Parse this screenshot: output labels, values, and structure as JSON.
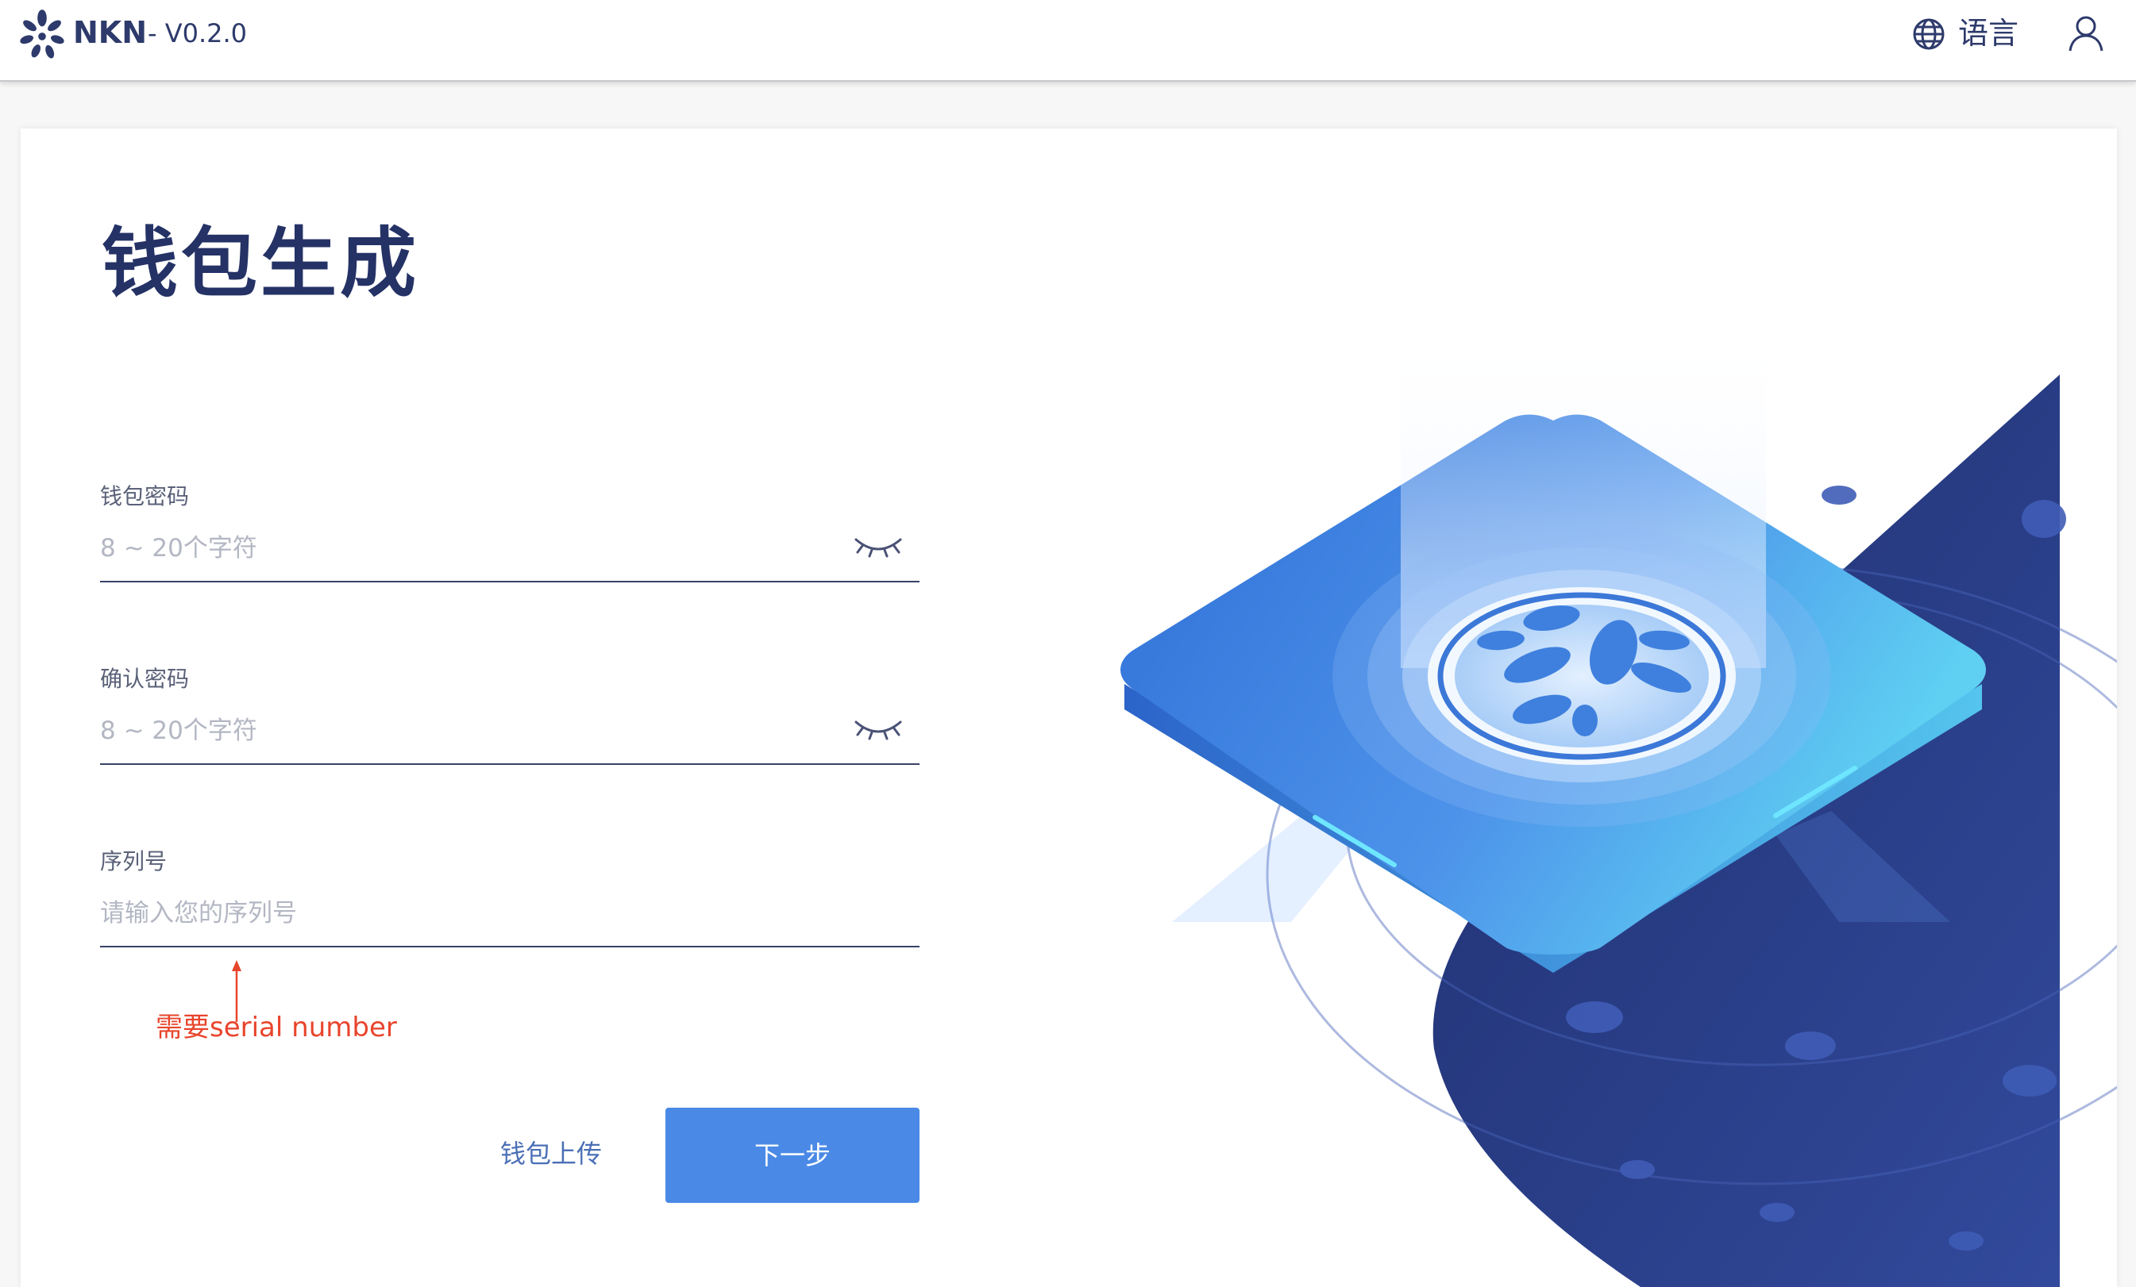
{
  "header": {
    "brand": "NKN",
    "version": "- V0.2.0",
    "language_label": "语言"
  },
  "form": {
    "title": "钱包生成",
    "password": {
      "label": "钱包密码",
      "placeholder": "8 ~ 20个字符",
      "value": ""
    },
    "confirm_password": {
      "label": "确认密码",
      "placeholder": "8 ~ 20个字符",
      "value": ""
    },
    "serial": {
      "label": "序列号",
      "placeholder": "请输入您的序列号",
      "value": ""
    },
    "annotation": "需要serial number",
    "upload_link": "钱包上传",
    "next_button": "下一步"
  },
  "icons": {
    "logo": "nkn-flower-logo",
    "language": "globe-icon",
    "user": "user-icon",
    "password_toggle": "eye-closed-icon"
  },
  "colors": {
    "brand": "#2d3a6b",
    "title": "#253266",
    "primary_button": "#4a8ae6",
    "link": "#4a6fb5",
    "annotation": "#e8452c",
    "illustration_dark": "#2a3d8a"
  }
}
